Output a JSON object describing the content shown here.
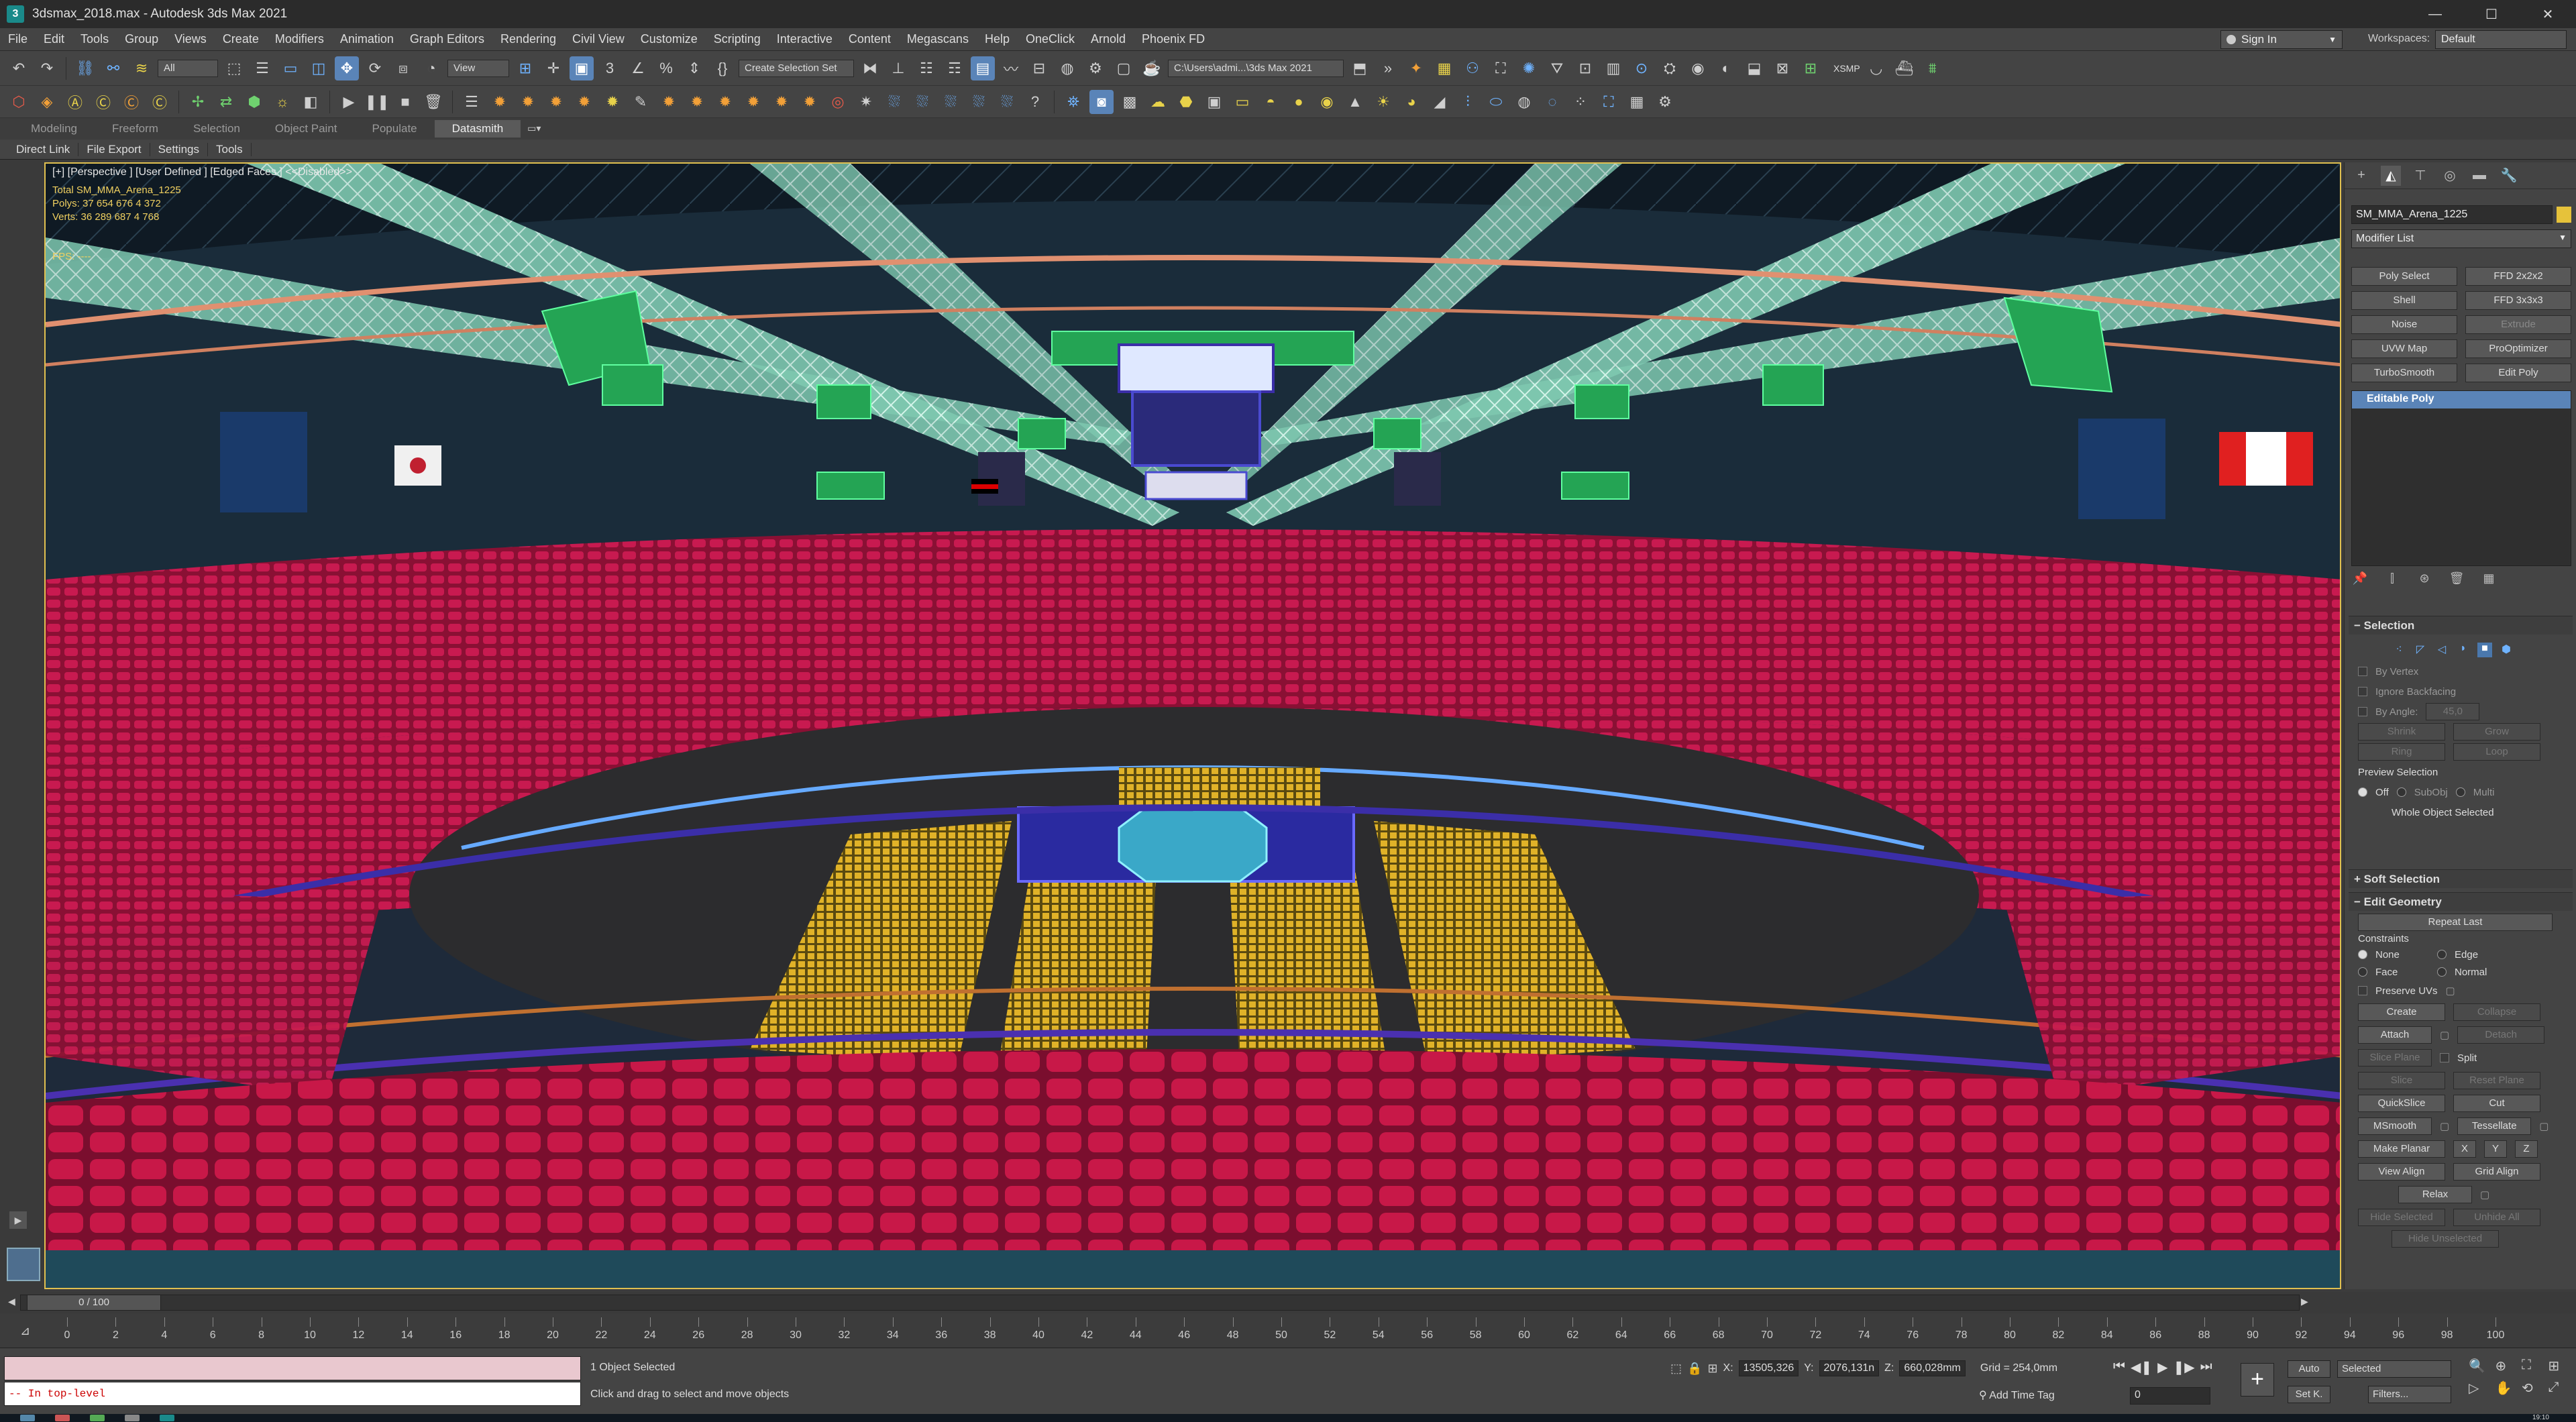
{
  "titlebar": {
    "title": "3dsmax_2018.max - Autodesk 3ds Max 2021",
    "icon": "3ds-max-logo-icon",
    "buttons": [
      "minimize-icon",
      "maximize-icon",
      "close-icon"
    ]
  },
  "menubar": {
    "items": [
      "File",
      "Edit",
      "Tools",
      "Group",
      "Views",
      "Create",
      "Modifiers",
      "Animation",
      "Graph Editors",
      "Rendering",
      "Civil View",
      "Customize",
      "Scripting",
      "Interactive",
      "Content",
      "Megascans",
      "Help",
      "OneClick",
      "Arnold",
      "Phoenix FD"
    ],
    "sign_in": "Sign In",
    "workspaces_label": "Workspaces:",
    "workspaces_value": "Default"
  },
  "toolbar1": {
    "selection_filter": "All",
    "ref_coord": "View",
    "named_selection": "Create Selection Set",
    "project_path": "C:\\Users\\admi...\\3ds Max 2021",
    "xsmp": "XSMP"
  },
  "ribbon": {
    "tabs": [
      "Modeling",
      "Freeform",
      "Selection",
      "Object Paint",
      "Populate",
      "Datasmith"
    ],
    "active_tab": "Datasmith",
    "sub_tabs": [
      "Direct Link",
      "File Export",
      "Settings",
      "Tools"
    ]
  },
  "viewport": {
    "label": "[+] [Perspective ] [User Defined ] [Edged Faces ]  <<Disabled>>",
    "stats": [
      "Total       SM_MMA_Arena_1225",
      "Polys:  37 654 676     4 372",
      "Verts:  36 289 687     4 768"
    ],
    "fps": "FPS:      ----"
  },
  "command_panel": {
    "object_name": "SM_MMA_Arena_1225",
    "object_color": "#e6c23a",
    "modifier_list": "Modifier List",
    "modifier_buttons": [
      {
        "label": "Poly Select",
        "enabled": true
      },
      {
        "label": "FFD 2x2x2",
        "enabled": true
      },
      {
        "label": "Shell",
        "enabled": true
      },
      {
        "label": "FFD 3x3x3",
        "enabled": true
      },
      {
        "label": "Noise",
        "enabled": true
      },
      {
        "label": "Extrude",
        "enabled": false
      },
      {
        "label": "UVW Map",
        "enabled": true
      },
      {
        "label": "ProOptimizer",
        "enabled": true
      },
      {
        "label": "TurboSmooth",
        "enabled": true
      },
      {
        "label": "Edit Poly",
        "enabled": true
      }
    ],
    "stack_item": "Editable Poly",
    "selection": {
      "title": "Selection",
      "by_vertex": "By Vertex",
      "ignore_backfacing": "Ignore Backfacing",
      "by_angle": "By Angle:",
      "by_angle_value": "45,0",
      "shrink": "Shrink",
      "grow": "Grow",
      "ring": "Ring",
      "loop": "Loop",
      "preview_selection": "Preview Selection",
      "off": "Off",
      "subobj": "SubObj",
      "multi": "Multi",
      "whole_object": "Whole Object Selected"
    },
    "soft_selection": "Soft Selection",
    "edit_geometry": {
      "title": "Edit Geometry",
      "repeat_last": "Repeat Last",
      "constraints": "Constraints",
      "none": "None",
      "edge": "Edge",
      "face": "Face",
      "normal": "Normal",
      "preserve_uvs": "Preserve UVs",
      "create": "Create",
      "collapse": "Collapse",
      "attach": "Attach",
      "detach": "Detach",
      "slice_plane": "Slice Plane",
      "split": "Split",
      "slice": "Slice",
      "reset_plane": "Reset Plane",
      "quickslice": "QuickSlice",
      "cut": "Cut",
      "msmooth": "MSmooth",
      "tessellate": "Tessellate",
      "make_planar": "Make Planar",
      "x": "X",
      "y": "Y",
      "z": "Z",
      "view_align": "View Align",
      "grid_align": "Grid Align",
      "relax": "Relax",
      "hide_selected": "Hide Selected",
      "unhide_all": "Unhide All",
      "hide_unselected": "Hide Unselected"
    }
  },
  "timeline": {
    "frame_display": "0 / 100",
    "ticks": [
      0,
      2,
      4,
      6,
      8,
      10,
      12,
      14,
      16,
      18,
      20,
      22,
      24,
      26,
      28,
      30,
      32,
      34,
      36,
      38,
      40,
      42,
      44,
      46,
      48,
      50,
      52,
      54,
      56,
      58,
      60,
      62,
      64,
      66,
      68,
      70,
      72,
      74,
      76,
      78,
      80,
      82,
      84,
      86,
      88,
      90,
      92,
      94,
      96,
      98,
      100
    ]
  },
  "status": {
    "maxscript_output": "-- In top-level",
    "selection_info": "1 Object Selected",
    "prompt": "Click and drag to select and move objects",
    "x_label": "X:",
    "x": "13505,326",
    "y_label": "Y:",
    "y": "2076,131n",
    "z_label": "Z:",
    "z": "660,028mm",
    "grid": "Grid = 254,0mm",
    "add_time_tag": "Add Time Tag",
    "frame": "0",
    "auto": "Auto",
    "selected": "Selected",
    "set_k": "Set K.",
    "filters": "Filters..."
  },
  "taskbar": {
    "clock": "19:10"
  },
  "colors": {
    "seats": "#c0184a",
    "floor_seats": "#d8a820",
    "rails_blue": "#3b2ea8",
    "wireframe_green": "#28b85a",
    "truss": "#9ee8c8",
    "viewport_border": "#e0c050"
  }
}
